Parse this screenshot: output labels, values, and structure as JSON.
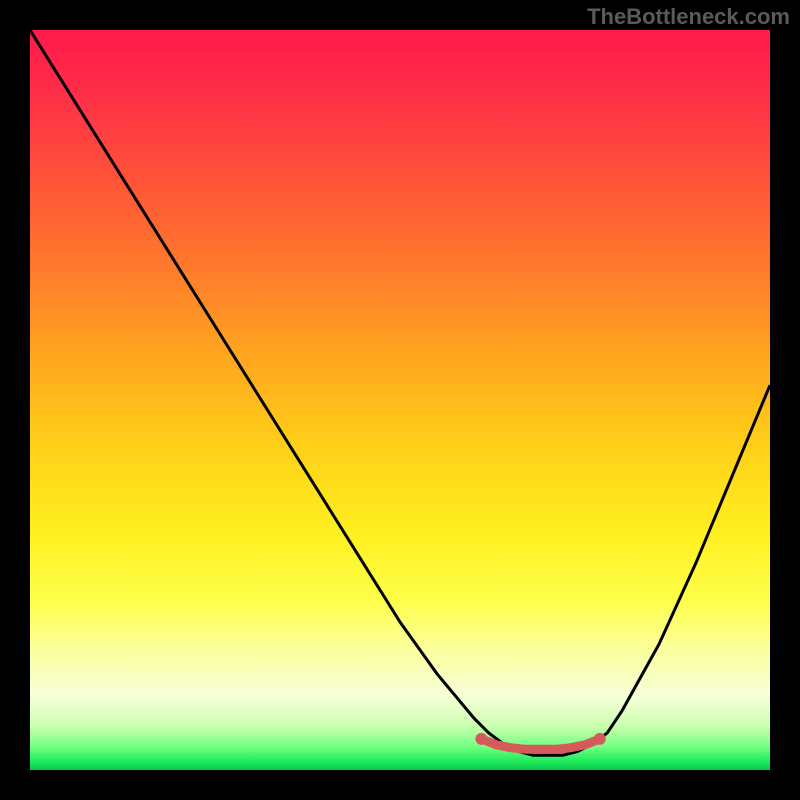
{
  "watermark": "TheBottleneck.com",
  "chart_data": {
    "type": "line",
    "title": "",
    "xlabel": "",
    "ylabel": "",
    "xlim": [
      0,
      100
    ],
    "ylim": [
      0,
      100
    ],
    "series": [
      {
        "name": "curve",
        "x": [
          0,
          5,
          10,
          15,
          20,
          25,
          30,
          35,
          40,
          45,
          50,
          55,
          60,
          62,
          64,
          66,
          68,
          70,
          72,
          74,
          76,
          78,
          80,
          85,
          90,
          95,
          100
        ],
        "y": [
          100,
          92,
          84,
          76,
          68,
          60,
          52,
          44,
          36,
          28,
          20,
          13,
          7,
          5,
          3.5,
          2.5,
          2,
          2,
          2,
          2.5,
          3.5,
          5,
          8,
          17,
          28,
          40,
          52
        ]
      },
      {
        "name": "marker-band",
        "x": [
          61,
          63,
          65,
          67,
          69,
          71,
          73,
          75,
          77
        ],
        "y": [
          4.2,
          3.4,
          3.0,
          2.8,
          2.8,
          2.8,
          3.0,
          3.4,
          4.2
        ]
      }
    ],
    "colors": {
      "curve": "#000000",
      "marker": "#d65a5a"
    }
  }
}
